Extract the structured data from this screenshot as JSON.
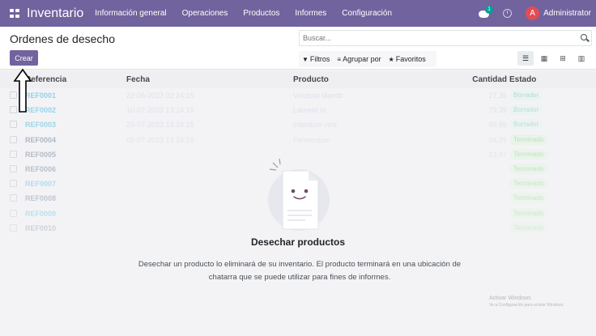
{
  "navbar": {
    "brand": "Inventario",
    "menu": [
      "Información general",
      "Operaciones",
      "Productos",
      "Informes",
      "Configuración"
    ],
    "messages_badge": "1",
    "user_initial": "A",
    "user_name": "Administrator"
  },
  "control": {
    "title": "Ordenes de desecho",
    "create_label": "Crear",
    "search_placeholder": "Buscar...",
    "filters_label": "Filtros",
    "groupby_label": "Agrupar por",
    "favorites_label": "Favoritos"
  },
  "table": {
    "headers": {
      "ref": "Referencia",
      "date": "Fecha",
      "product": "Producto",
      "qty": "Cantidad",
      "state": "Estado"
    },
    "rows": [
      {
        "ref": "REF0001",
        "date": "22-06-2023 02:24:15",
        "product": "Volutpat blandit",
        "qty": "27,35",
        "state": "Borrador"
      },
      {
        "ref": "REF0002",
        "date": "10-07-2023 13:24:15",
        "product": "Laoreet id",
        "qty": "79,39",
        "state": "Borrador"
      },
      {
        "ref": "REF0003",
        "date": "26-07-2023 13:24:15",
        "product": "Interdum velit",
        "qty": "99,86",
        "state": "Borrador"
      },
      {
        "ref": "REF0004",
        "date": "05-07-2023 13:24:15",
        "product": "Fermentum",
        "qty": "04,25",
        "state": "Terminado"
      },
      {
        "ref": "REF0005",
        "date": "",
        "product": "",
        "qty": "13,97",
        "state": "Terminado"
      },
      {
        "ref": "REF0006",
        "date": "",
        "product": "",
        "qty": "",
        "state": "Terminado"
      },
      {
        "ref": "REF0007",
        "date": "",
        "product": "",
        "qty": "",
        "state": "Terminado"
      },
      {
        "ref": "REF0008",
        "date": "",
        "product": "",
        "qty": "",
        "state": "Terminado"
      },
      {
        "ref": "REF0009",
        "date": "",
        "product": "",
        "qty": "",
        "state": "Terminado"
      },
      {
        "ref": "REF0010",
        "date": "",
        "product": "",
        "qty": "",
        "state": "Terminado"
      }
    ]
  },
  "helper": {
    "title": "Desechar productos",
    "text": "Desechar un producto lo eliminará de su inventario. El producto terminará en una ubicación de chatarra que se puede utilizar para fines de informes."
  },
  "watermark": {
    "line1": "Activar Windows",
    "line2": "Ve a Configuración para activar Windows."
  },
  "colors": {
    "brand": "#71639e",
    "badge": "#00a09d",
    "avatar": "#e24c55"
  }
}
